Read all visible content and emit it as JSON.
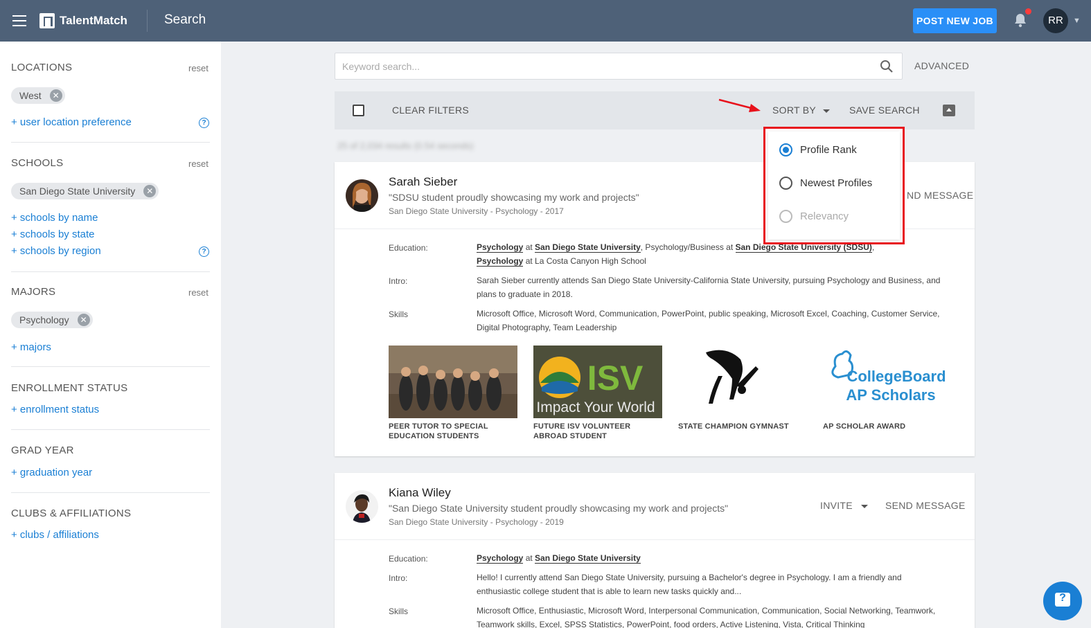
{
  "header": {
    "brand": "TalentMatch",
    "page_title": "Search",
    "post_job_label": "POST NEW JOB",
    "user_initials": "RR"
  },
  "sidebar": {
    "locations": {
      "title": "LOCATIONS",
      "reset": "reset",
      "chips": [
        "West"
      ],
      "link": "+ user location preference"
    },
    "schools": {
      "title": "SCHOOLS",
      "reset": "reset",
      "chips": [
        "San Diego State University"
      ],
      "links": [
        "+ schools by name",
        "+ schools by state",
        "+ schools by region"
      ]
    },
    "majors": {
      "title": "MAJORS",
      "reset": "reset",
      "chips": [
        "Psychology"
      ],
      "link": "+ majors"
    },
    "enrollment": {
      "title": "ENROLLMENT STATUS",
      "link": "+ enrollment status"
    },
    "grad_year": {
      "title": "GRAD YEAR",
      "link": "+ graduation year"
    },
    "clubs": {
      "title": "CLUBS & AFFILIATIONS",
      "link": "+ clubs / affiliations"
    }
  },
  "search": {
    "placeholder": "Keyword search...",
    "advanced_label": "ADVANCED"
  },
  "toolbar": {
    "clear_filters": "CLEAR FILTERS",
    "sort_by": "SORT BY",
    "save_search": "SAVE SEARCH"
  },
  "results_count": "25 of 2,034 results (0.54 seconds)",
  "sort_menu": {
    "options": [
      {
        "label": "Profile Rank",
        "selected": true,
        "disabled": false
      },
      {
        "label": "Newest Profiles",
        "selected": false,
        "disabled": false
      },
      {
        "label": "Relevancy",
        "selected": false,
        "disabled": true
      }
    ]
  },
  "profiles": [
    {
      "name": "Sarah Sieber",
      "tagline": "\"SDSU student proudly showcasing my work and projects\"",
      "meta": "San Diego State University - Psychology - 2017",
      "send_message": "ND MESSAGE",
      "labels": {
        "education": "Education:",
        "intro": "Intro:",
        "skills": "Skills"
      },
      "education_parts": [
        "Psychology",
        " at ",
        "San Diego State University",
        ", Psychology/Business at ",
        "San Diego State University (SDSU)",
        ",",
        "Psychology",
        " at La Costa Canyon High School"
      ],
      "intro": "Sarah Sieber currently attends San Diego State University-California State University, pursuing Psychology and Business, and plans to graduate in 2018.",
      "skills": "Microsoft Office, Microsoft Word, Communication, PowerPoint, public speaking, Microsoft Excel, Coaching, Customer Service, Digital Photography, Team Leadership",
      "highlights": [
        {
          "caption": "PEER TUTOR TO SPECIAL EDUCATION STUDENTS"
        },
        {
          "caption": "FUTURE ISV VOLUNTEER ABROAD STUDENT",
          "image_text": [
            "ISV",
            "Impact Your World"
          ]
        },
        {
          "caption": "STATE CHAMPION GYMNAST"
        },
        {
          "caption": "AP SCHOLAR AWARD",
          "image_text": [
            "CollegeBoard",
            "AP Scholars"
          ]
        }
      ]
    },
    {
      "name": "Kiana Wiley",
      "tagline": "\"San Diego State University student proudly showcasing my work and projects\"",
      "meta": "San Diego State University - Psychology - 2019",
      "invite": "INVITE",
      "send_message": "SEND MESSAGE",
      "labels": {
        "education": "Education:",
        "intro": "Intro:",
        "skills": "Skills"
      },
      "education_parts": [
        "Psychology",
        " at ",
        "San Diego State University"
      ],
      "intro": "Hello! I currently attend San Diego State University, pursuing a Bachelor's degree in Psychology. I am a friendly and enthusiastic college student that is able to learn new tasks quickly and...",
      "skills": "Microsoft Office, Enthusiastic, Microsoft Word, Interpersonal Communication, Communication, Social Networking, Teamwork, Teamwork skills, Excel, SPSS Statistics, PowerPoint, food orders, Active Listening, Vista, Critical Thinking"
    }
  ],
  "colors": {
    "topbar": "#4e6178",
    "accent": "#1a7fd4",
    "post_job": "#2a8ff7",
    "highlight_box": "#e8121c"
  }
}
